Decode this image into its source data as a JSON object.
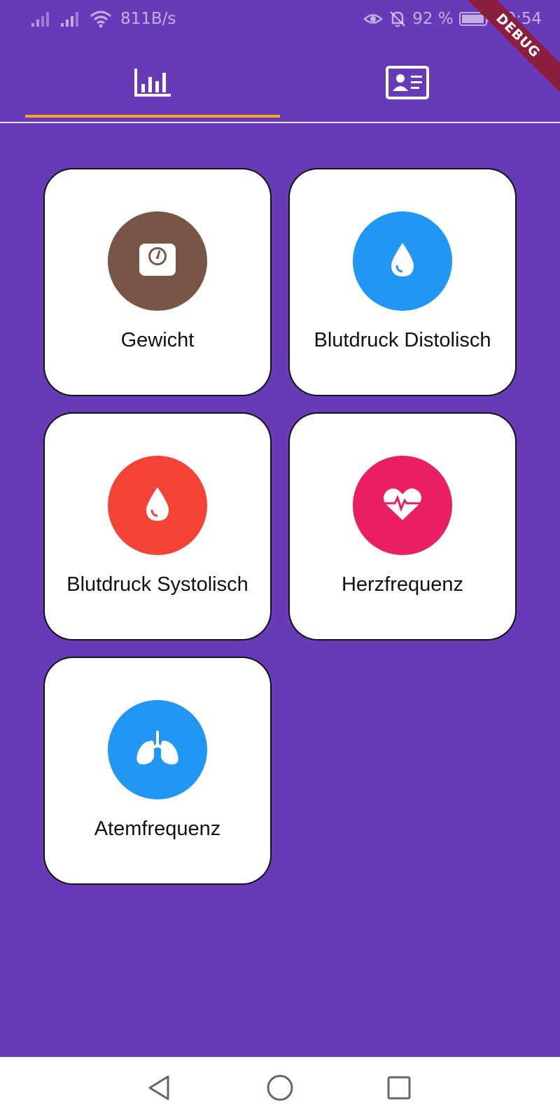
{
  "status_bar": {
    "network_speed": "811B/s",
    "battery_percent": "92 %",
    "time": "10:54",
    "icons": [
      "signal-icon",
      "signal-icon",
      "wifi-icon",
      "eye-icon",
      "bell-off-icon",
      "battery-icon"
    ]
  },
  "debug_banner": "DEBUG",
  "tabs": [
    {
      "icon": "bar-chart-icon",
      "selected": true
    },
    {
      "icon": "id-card-icon",
      "selected": false
    }
  ],
  "tiles": [
    {
      "label": "Gewicht",
      "icon": "scale-icon",
      "color": "#795548"
    },
    {
      "label": "Blutdruck Distolisch",
      "icon": "water-drop-icon",
      "color": "#2196F3"
    },
    {
      "label": "Blutdruck Systolisch",
      "icon": "water-drop-icon",
      "color": "#F44336"
    },
    {
      "label": "Herzfrequenz",
      "icon": "heart-pulse-icon",
      "color": "#E91E63"
    },
    {
      "label": "Atemfrequenz",
      "icon": "lungs-icon",
      "color": "#2196F3"
    }
  ],
  "colors": {
    "background": "#673AB7",
    "tab_indicator": "#F5A623"
  },
  "nav_bar": {
    "icons": [
      "back-triangle-icon",
      "home-circle-icon",
      "recents-square-icon"
    ]
  }
}
